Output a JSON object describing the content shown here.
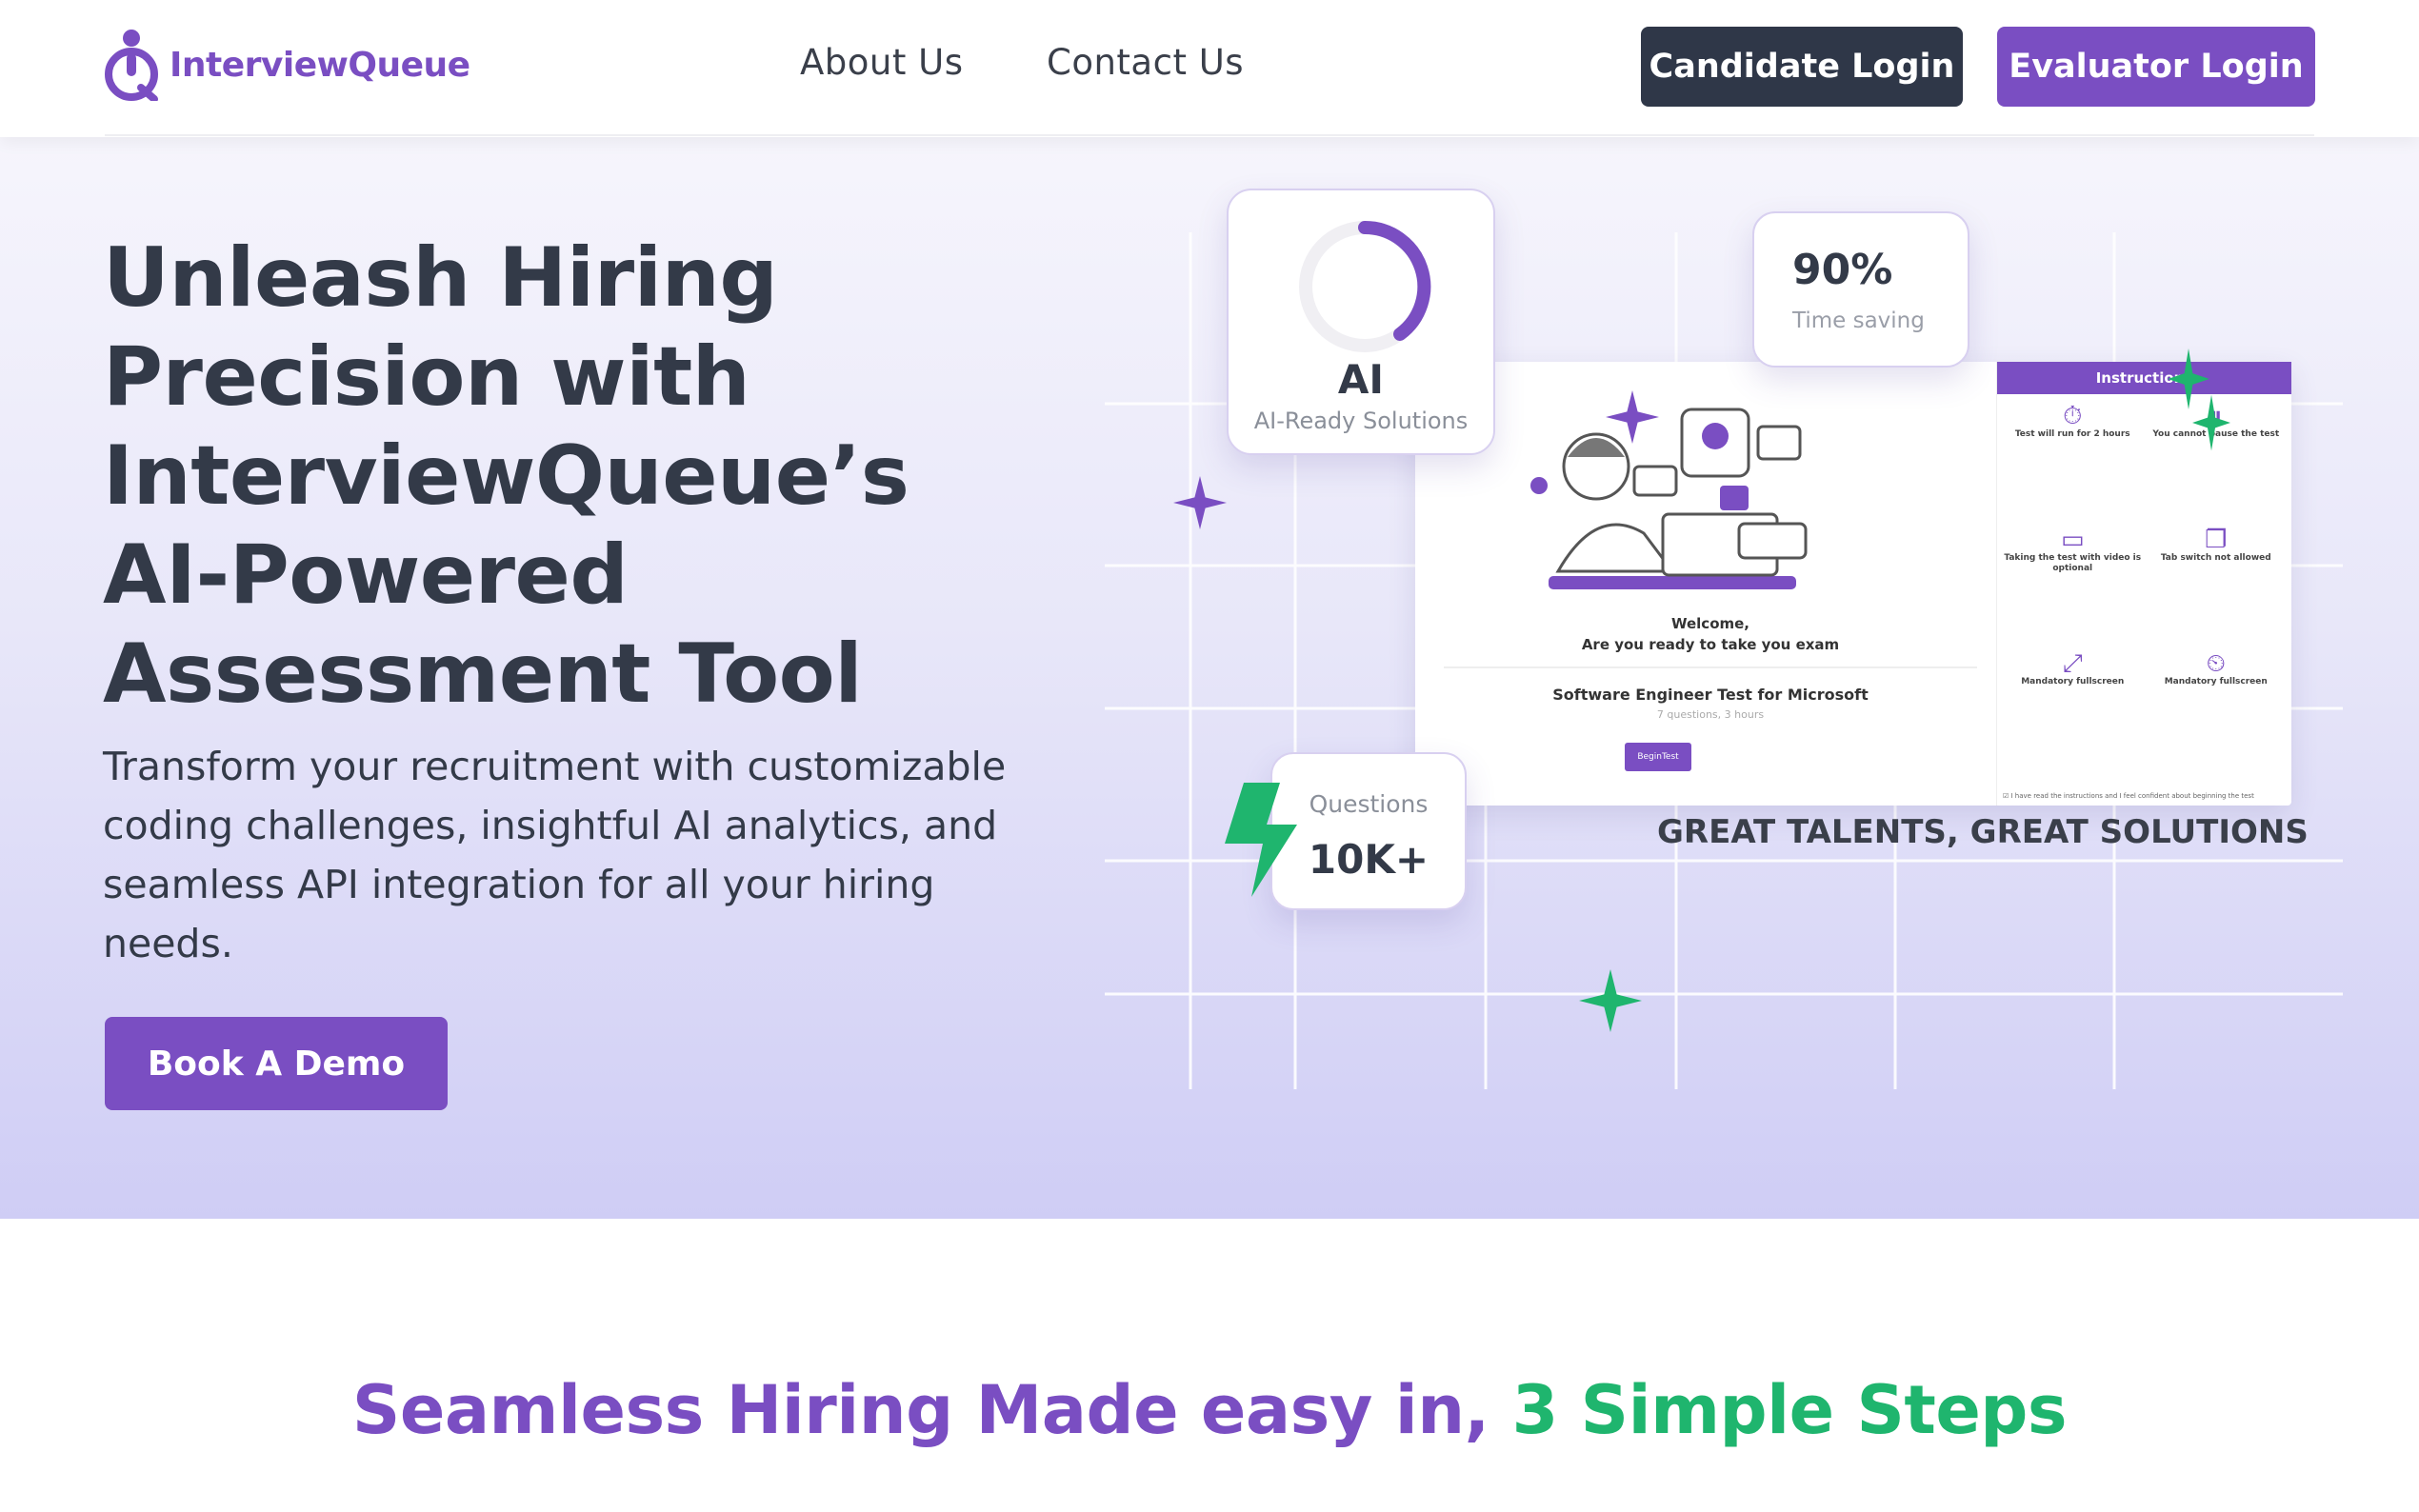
{
  "brand": {
    "name": "InterviewQueue",
    "color": "#7a4ec2"
  },
  "nav": {
    "about": "About Us",
    "contact": "Contact Us"
  },
  "auth": {
    "candidate_login": "Candidate Login",
    "evaluator_login": "Evaluator Login"
  },
  "hero": {
    "title": "Unleash Hiring Precision with InterviewQueue’s AI-Powered Assessment Tool",
    "subtitle": "Transform your recruitment with customizable coding challenges, insightful AI analytics, and seamless API integration for all your hiring needs.",
    "cta": "Book A Demo"
  },
  "illustration": {
    "ai_title": "AI",
    "ai_sub": "AI-Ready Solutions",
    "time_value": "90%",
    "time_label": "Time saving",
    "questions_label": "Questions",
    "questions_value": "10K+",
    "tagline": "GREAT TALENTS, GREAT SOLUTIONS",
    "screen": {
      "welcome_line1": "Welcome,",
      "welcome_line2": "Are you ready to take you exam",
      "test_title": "Software Engineer Test for Microsoft",
      "test_meta": "7 questions, 3 hours",
      "begin": "BeginTest",
      "instructions_title": "Instructions",
      "instructions": [
        {
          "icon": "timer-icon",
          "text": "Test will run for 2 hours"
        },
        {
          "icon": "pause-icon",
          "text": "You cannot pause the test"
        },
        {
          "icon": "video-icon",
          "text": "Taking the test with video is optional"
        },
        {
          "icon": "window-icon",
          "text": "Tab switch not allowed"
        },
        {
          "icon": "fullscreen-icon",
          "text": "Mandatory fullscreen"
        },
        {
          "icon": "stopwatch-icon",
          "text": "Mandatory fullscreen"
        }
      ],
      "agree": "I have read the instructions and I feel confident about beginning the test"
    }
  },
  "steps": {
    "title_part1": "Seamless Hiring Made easy in, ",
    "title_part2": "3 Simple Steps"
  },
  "colors": {
    "dark_button": "#2f3748",
    "accent_green": "#1fb56e"
  }
}
